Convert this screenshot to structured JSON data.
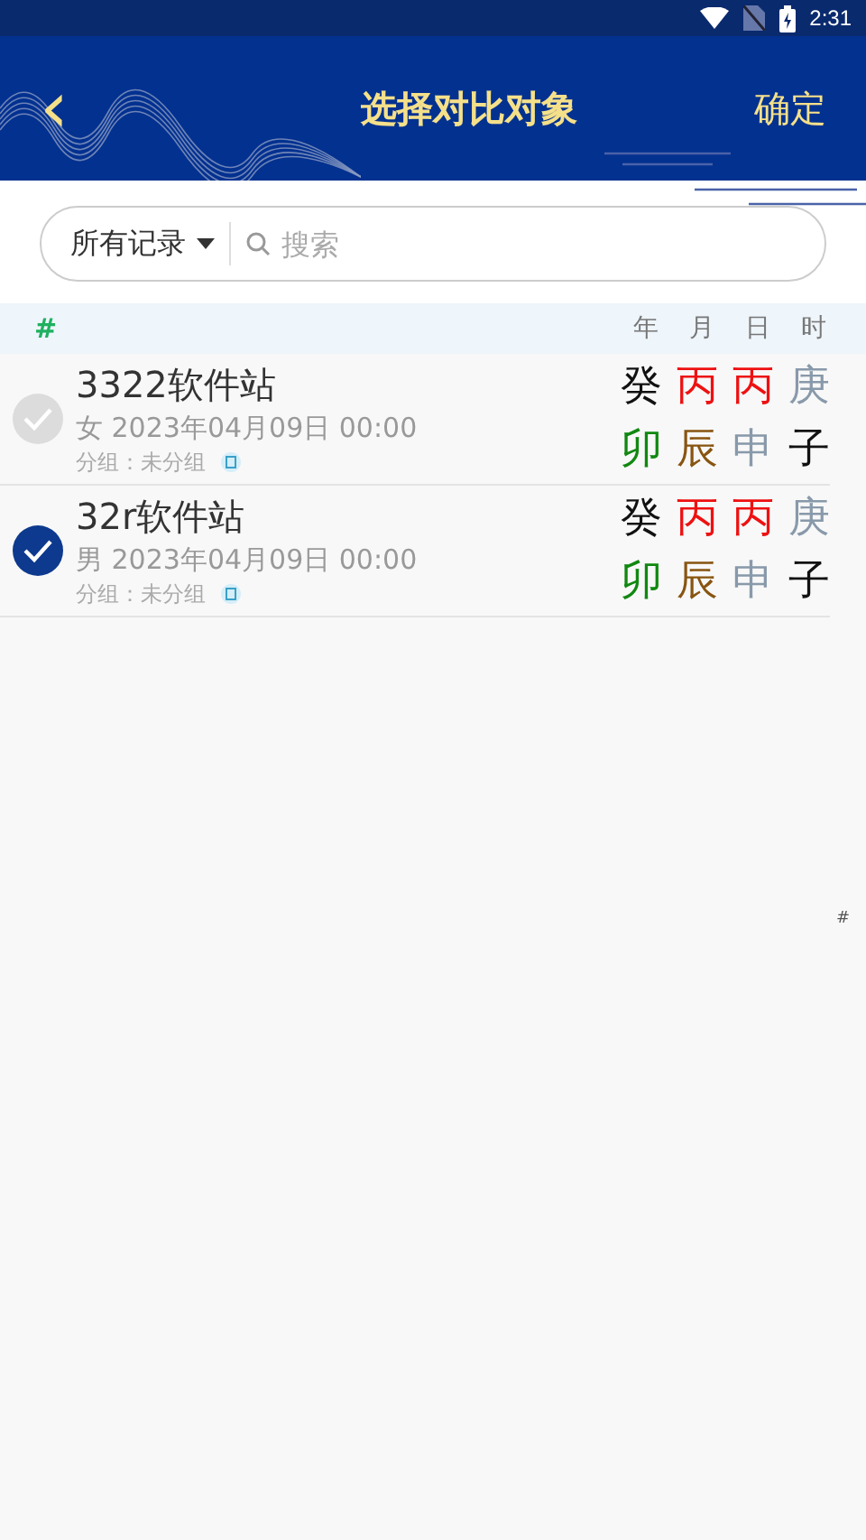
{
  "status_bar": {
    "time": "2:31"
  },
  "header": {
    "back_icon": "‹",
    "title": "选择对比对象",
    "confirm": "确定"
  },
  "filter": {
    "dropdown": "所有记录",
    "placeholder": "搜索"
  },
  "list_header": {
    "section": "#",
    "columns": [
      "年",
      "月",
      "日",
      "时"
    ]
  },
  "records": [
    {
      "name": "3322软件站",
      "info": "女 2023年04月09日 00:00",
      "group": "分组：未分组",
      "selected": false,
      "pillars": [
        [
          {
            "char": "癸",
            "color": "#111111"
          },
          {
            "char": "丙",
            "color": "#ee1111"
          },
          {
            "char": "丙",
            "color": "#ee1111"
          },
          {
            "char": "庚",
            "color": "#8899aa"
          }
        ],
        [
          {
            "char": "卯",
            "color": "#118811"
          },
          {
            "char": "辰",
            "color": "#885511"
          },
          {
            "char": "申",
            "color": "#8899aa"
          },
          {
            "char": "子",
            "color": "#111111"
          }
        ]
      ]
    },
    {
      "name": "32r软件站",
      "info": "男 2023年04月09日 00:00",
      "group": "分组：未分组",
      "selected": true,
      "pillars": [
        [
          {
            "char": "癸",
            "color": "#111111"
          },
          {
            "char": "丙",
            "color": "#ee1111"
          },
          {
            "char": "丙",
            "color": "#ee1111"
          },
          {
            "char": "庚",
            "color": "#8899aa"
          }
        ],
        [
          {
            "char": "卯",
            "color": "#118811"
          },
          {
            "char": "辰",
            "color": "#885511"
          },
          {
            "char": "申",
            "color": "#8899aa"
          },
          {
            "char": "子",
            "color": "#111111"
          }
        ]
      ]
    }
  ],
  "index_bar": [
    "#"
  ]
}
